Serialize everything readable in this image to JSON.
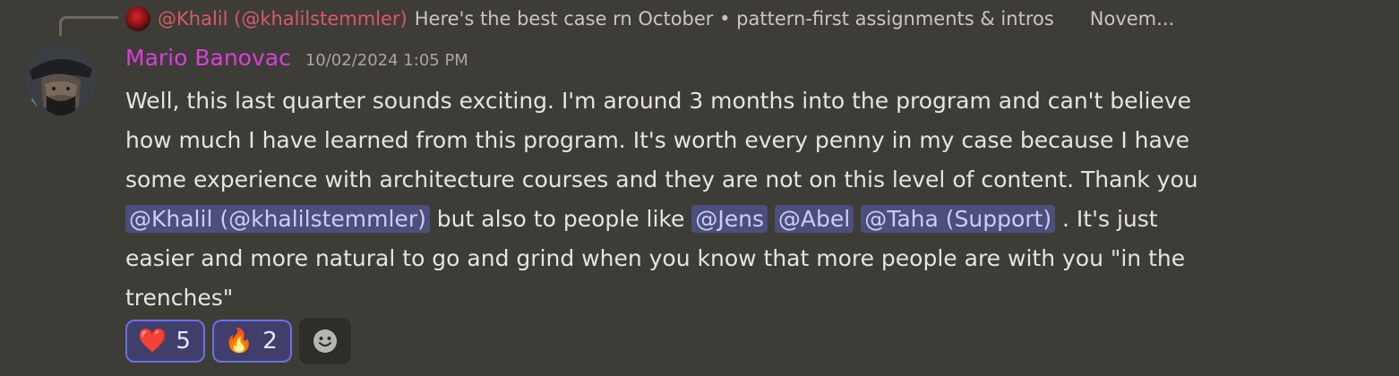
{
  "reply": {
    "author": "@Khalil (@khalilstemmler)",
    "text": "Here's the best case rn  October • pattern-first assignments & intros",
    "more": "Novem..."
  },
  "message": {
    "author": "Mario Banovac",
    "timestamp": "10/02/2024 1:05 PM",
    "lines": {
      "l1": "Well, this last quarter sounds exciting. I'm around 3 months into the program and can't believe",
      "l2": "how much I have learned from this program. It's worth every penny in my case because I have",
      "l3": "some experience with architecture courses and they are not on this level of content. Thank you",
      "l4_mention1": "@Khalil (@khalilstemmler)",
      "l4_text1": " but also to people like ",
      "l4_mention2": "@Jens",
      "l4_mention3": "@Abel",
      "l4_mention4": "@Taha (Support)",
      "l4_text2": " . It's just",
      "l5": "easier and more natural to go and grind when you know that more people are with you \"in the",
      "l6": "trenches\""
    }
  },
  "reactions": [
    {
      "emoji": "❤️",
      "icon": "heart-icon",
      "count": "5"
    },
    {
      "emoji": "🔥",
      "icon": "fire-icon",
      "count": "2"
    }
  ],
  "colors": {
    "background": "#3e3c37",
    "author": "#d840d8",
    "reply_author": "#d65a68",
    "mention_bg": "#4c4f7a",
    "reaction_border": "#6d70e0"
  }
}
